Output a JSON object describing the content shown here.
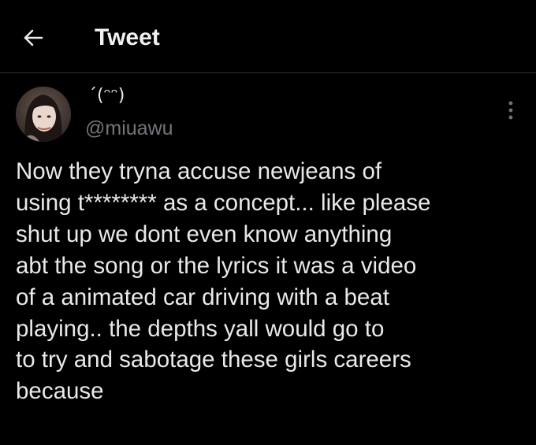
{
  "header": {
    "title": "Tweet",
    "back_icon": "arrow-left-icon"
  },
  "tweet": {
    "author": {
      "display_name": "ˊ(ᵔᵔ)",
      "handle": "@miuawu",
      "avatar": "avatar-photo"
    },
    "more_icon": "more-vertical-icon",
    "text": "Now they tryna accuse newjeans of\nusing t******** as a concept... like please\nshut up we dont even know anything\nabt the song or the lyrics it was a video\nof a animated car driving with a beat\nplaying.. the depths yall would go to\nto try and sabotage these girls careers\nbecause"
  },
  "colors": {
    "background": "#000000",
    "primary_text": "#e7e9ea",
    "secondary_text": "#71767b",
    "divider": "#2f3336"
  }
}
